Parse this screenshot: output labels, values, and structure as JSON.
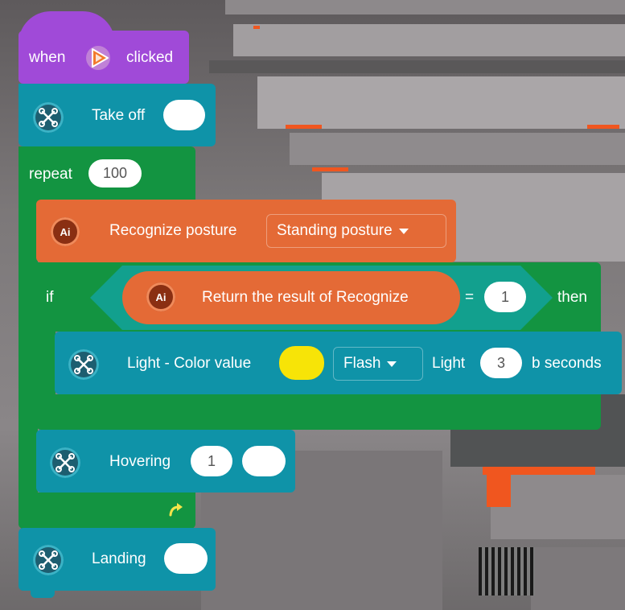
{
  "hat": {
    "when_label": "when",
    "clicked_label": "clicked",
    "icon": "play-flag-icon"
  },
  "takeoff": {
    "label": "Take off",
    "value": ""
  },
  "repeat": {
    "label": "repeat",
    "count": "100",
    "loop_icon": "loop-arrow-icon"
  },
  "recognize": {
    "label": "Recognize posture",
    "option": "Standing posture"
  },
  "if_block": {
    "if_label": "if",
    "then_label": "then"
  },
  "condition": {
    "label": "Return the result of Recognize",
    "operator": "=",
    "value": "1"
  },
  "light": {
    "label": "Light - Color value",
    "color": "#f7e407",
    "mode": "Flash",
    "mode_label": "Light",
    "seconds": "3",
    "seconds_label": "b seconds"
  },
  "hovering": {
    "label": "Hovering",
    "value": "1",
    "value2": ""
  },
  "landing": {
    "label": "Landing",
    "value": ""
  },
  "colors": {
    "purple": "#a04ad8",
    "teal": "#0f93a8",
    "green": "#139441",
    "orange": "#e46a36"
  }
}
